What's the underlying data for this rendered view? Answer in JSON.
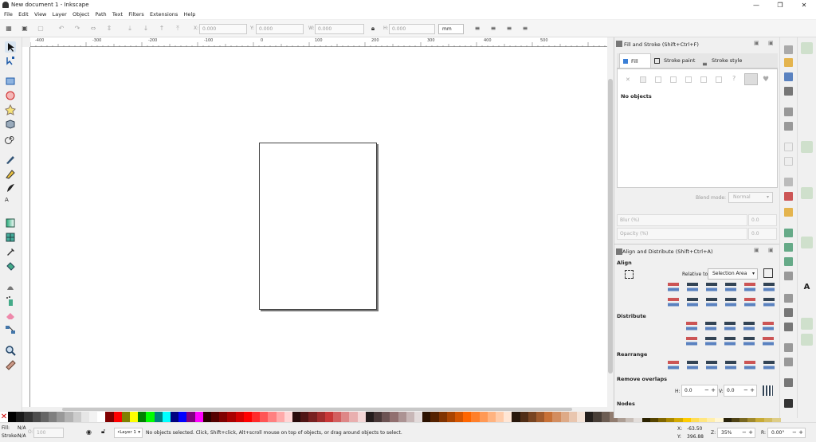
{
  "window": {
    "title": "New document 1 - Inkscape",
    "min": "—",
    "max": "❐",
    "close": "✕"
  },
  "menu": [
    "File",
    "Edit",
    "View",
    "Layer",
    "Object",
    "Path",
    "Text",
    "Filters",
    "Extensions",
    "Help"
  ],
  "toolctrl": {
    "x_label": "X:",
    "x_value": "0.000",
    "y_label": "Y:",
    "y_value": "0.000",
    "w_label": "W:",
    "w_value": "0.000",
    "h_label": "H:",
    "h_value": "0.000",
    "unit": "mm"
  },
  "ruler": {
    "top_labels": [
      "-400",
      "-300",
      "-200",
      "-100",
      "0",
      "100",
      "200",
      "300",
      "400",
      "500"
    ]
  },
  "fill_stroke": {
    "title": "Fill and Stroke (Shift+Ctrl+F)",
    "tabs": [
      "Fill",
      "Stroke paint",
      "Stroke style"
    ],
    "empty_text": "No objects",
    "blend_label": "Blend mode:",
    "blend_value": "Normal",
    "blur_label": "Blur (%)",
    "blur_value": "0.0",
    "opacity_label": "Opacity (%)",
    "opacity_value": "0.0"
  },
  "align": {
    "title": "Align and Distribute (Shift+Ctrl+A)",
    "align_label": "Align",
    "relative_label": "Relative to:",
    "relative_value": "Selection Area",
    "distribute_label": "Distribute",
    "rearrange_label": "Rearrange",
    "overlaps_label": "Remove overlaps",
    "h_label": "H:",
    "h_value": "0.0",
    "v_label": "V:",
    "v_value": "0.0",
    "nodes_label": "Nodes"
  },
  "status": {
    "fill_label": "Fill:",
    "fill_value": "N/A",
    "stroke_label": "Stroke:",
    "stroke_value": "N/A",
    "opacity_label": "O:",
    "opacity_value": "100",
    "layer": "•Layer 1",
    "message": "No objects selected. Click, Shift+click, Alt+scroll mouse on top of objects, or drag around objects to select.",
    "x_label": "X:",
    "x_value": "-63.50",
    "y_label": "Y:",
    "y_value": "396.88",
    "zoom_label": "Z:",
    "zoom_value": "35%",
    "rot_label": "R:",
    "rot_value": "0.00°"
  },
  "palette": [
    "#000000",
    "#1a1a1a",
    "#333333",
    "#4d4d4d",
    "#666666",
    "#808080",
    "#999999",
    "#b3b3b3",
    "#cccccc",
    "#e6e6e6",
    "#f2f2f2",
    "#ffffff",
    "#800000",
    "#ff0000",
    "#808000",
    "#ffff00",
    "#008000",
    "#00ff00",
    "#008080",
    "#00ffff",
    "#000080",
    "#0000ff",
    "#800080",
    "#ff00ff",
    "#2b0000",
    "#550000",
    "#800000",
    "#aa0000",
    "#d40000",
    "#ff0000",
    "#ff2a2a",
    "#ff5555",
    "#ff8080",
    "#ffaaaa",
    "#ffd5d5",
    "#280b0b",
    "#501616",
    "#782121",
    "#a02c2c",
    "#c83737",
    "#d35f5f",
    "#de8787",
    "#e9afaf",
    "#f4d7d7",
    "#241c1c",
    "#483737",
    "#6c5353",
    "#916f6f",
    "#ac9393",
    "#c8b7b7",
    "#e3dbdb",
    "#2b1100",
    "#552200",
    "#803300",
    "#aa4400",
    "#d45500",
    "#ff6600",
    "#ff7f2a",
    "#ff9955",
    "#ffb380",
    "#ffccaa",
    "#ffe6d5",
    "#28170b",
    "#502d16",
    "#784421",
    "#a05a2c",
    "#c87137",
    "#d38d5f",
    "#deaa87",
    "#e9c6af",
    "#f4e3d7",
    "#241f1c",
    "#483e37",
    "#6c5d53",
    "#917c6f",
    "#ac9d93",
    "#c8beb7",
    "#e3dedb",
    "#2b2200",
    "#554400",
    "#806600",
    "#aa8800",
    "#d4aa00",
    "#ffcc00",
    "#ffdd55",
    "#ffe680",
    "#ffeeaa",
    "#fff6d5",
    "#28220b",
    "#504416",
    "#786721",
    "#a0892c",
    "#c8ab37",
    "#d3bc5f",
    "#decd87"
  ]
}
